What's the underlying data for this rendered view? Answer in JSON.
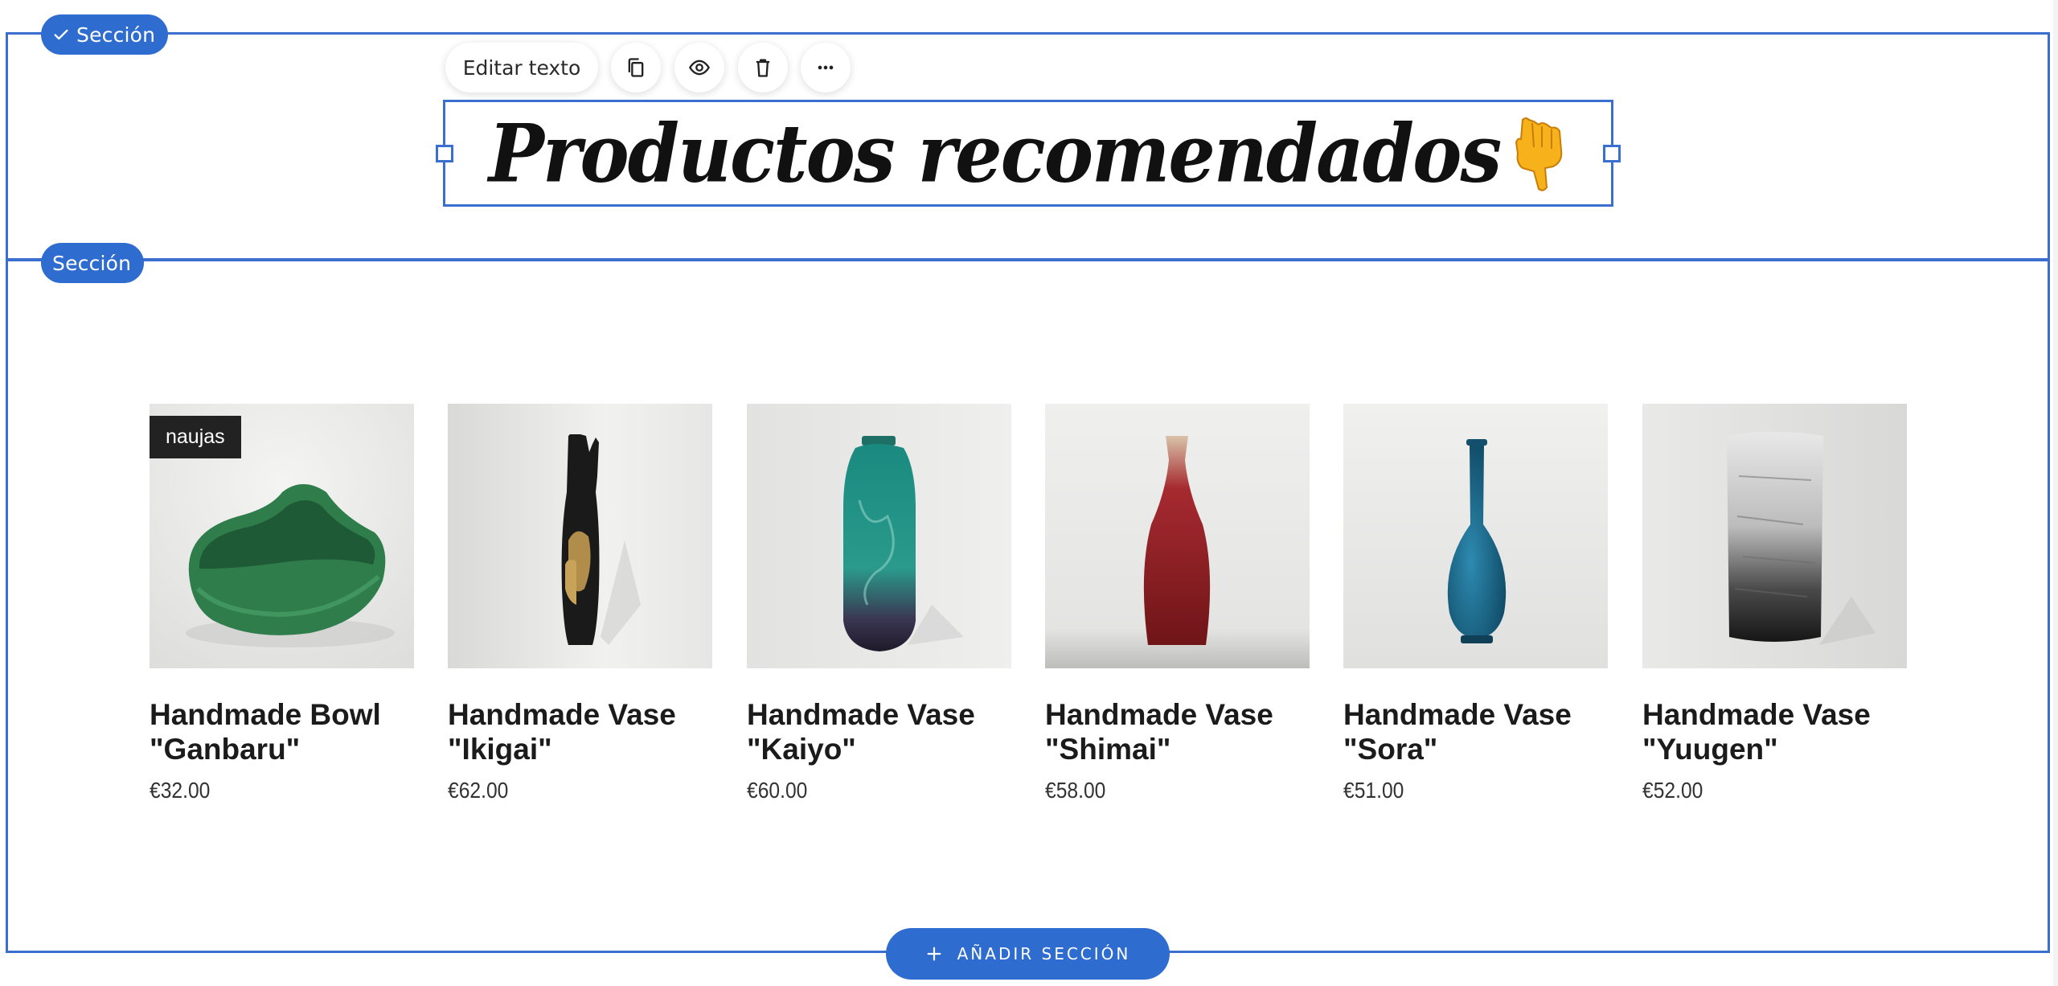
{
  "sections": {
    "selected_label": "Sección",
    "secondary_label": "Sección"
  },
  "toolbar": {
    "edit_label": "Editar texto"
  },
  "heading": {
    "text": "Productos recomendados"
  },
  "products": [
    {
      "name": "Handmade Bowl \"Ganbaru\"",
      "price": "€32.00",
      "badge": "naujas"
    },
    {
      "name": "Handmade Vase \"Ikigai\"",
      "price": "€62.00"
    },
    {
      "name": "Handmade Vase \"Kaiyo\"",
      "price": "€60.00"
    },
    {
      "name": "Handmade Vase \"Shimai\"",
      "price": "€58.00"
    },
    {
      "name": "Handmade Vase \"Sora\"",
      "price": "€51.00"
    },
    {
      "name": "Handmade Vase \"Yuugen\"",
      "price": "€52.00"
    }
  ],
  "add_section": {
    "label": "AÑADIR SECCIÓN"
  },
  "colors": {
    "accent": "#2f6cd0",
    "frame": "#3a6fd0"
  },
  "icons": [
    "check-icon",
    "copy-icon",
    "eye-icon",
    "trash-icon",
    "more-icon",
    "pointing-down-icon",
    "plus-icon"
  ]
}
